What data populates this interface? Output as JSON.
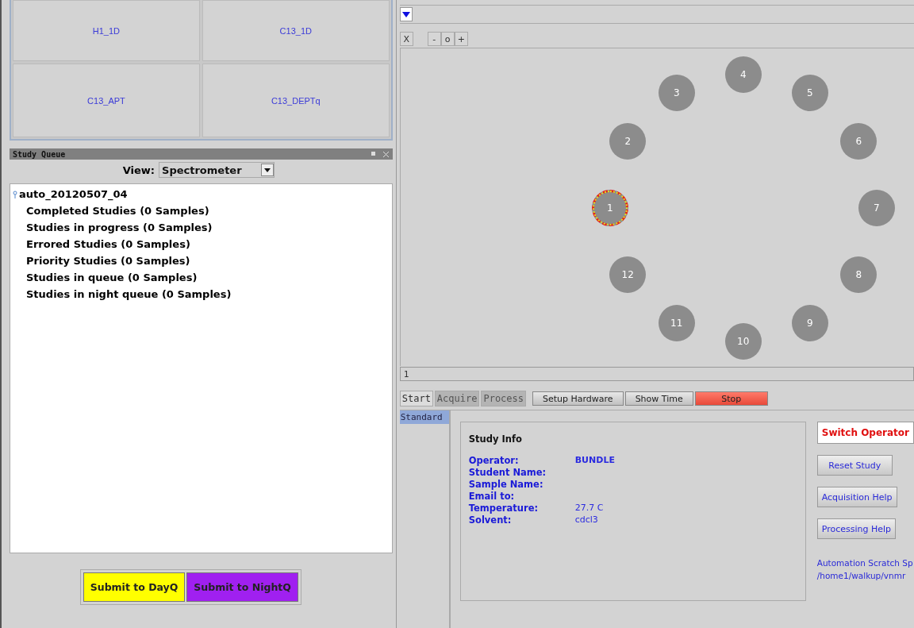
{
  "protocols": [
    {
      "label": "H1_1D"
    },
    {
      "label": "C13_1D"
    },
    {
      "label": "C13_APT"
    },
    {
      "label": "C13_DEPTq"
    }
  ],
  "study_queue": {
    "title": "Study Queue",
    "view_label": "View:",
    "view_value": "Spectrometer",
    "tree": {
      "label": "auto_20120507_04",
      "expanded": true,
      "children": [
        {
          "label": "Completed Studies (0 Samples)"
        },
        {
          "label": "Studies in progress (0 Samples)"
        },
        {
          "label": "Errored Studies (0 Samples)"
        },
        {
          "label": "Priority Studies (0 Samples)"
        },
        {
          "label": "Studies in queue (0 Samples)"
        },
        {
          "label": "Studies in night queue (0 Samples)"
        }
      ]
    },
    "buttons": [
      {
        "label": "Submit to DayQ",
        "color": "#ffff00"
      },
      {
        "label": "Submit to NightQ",
        "color": "#a020f0"
      }
    ]
  },
  "zoom_buttons": [
    "X",
    "-",
    "o",
    "+"
  ],
  "samples": [
    {
      "label": "1",
      "selected": true
    },
    {
      "label": "2",
      "selected": false
    },
    {
      "label": "3",
      "selected": false
    },
    {
      "label": "4",
      "selected": false
    },
    {
      "label": "5",
      "selected": false
    },
    {
      "label": "6",
      "selected": false
    },
    {
      "label": "7",
      "selected": false
    },
    {
      "label": "8",
      "selected": false
    },
    {
      "label": "9",
      "selected": false
    },
    {
      "label": "10",
      "selected": false
    },
    {
      "label": "11",
      "selected": false
    },
    {
      "label": "12",
      "selected": false
    }
  ],
  "location_field": {
    "value": "1"
  },
  "tabs": [
    {
      "label": "Start",
      "selected": true
    },
    {
      "label": "Acquire",
      "selected": false
    },
    {
      "label": "Process",
      "selected": false
    }
  ],
  "actions": [
    {
      "label": "Setup Hardware",
      "kind": "normal"
    },
    {
      "label": "Show Time",
      "kind": "normal"
    },
    {
      "label": "Stop",
      "kind": "danger"
    }
  ],
  "side_items": [
    {
      "label": "Standard",
      "selected": true
    }
  ],
  "study_info": {
    "title": "Study Info",
    "rows": [
      {
        "label": "Operator:",
        "value": "BUNDLE",
        "bold": true
      },
      {
        "label": "Student Name:"
      },
      {
        "label": "Sample Name:"
      },
      {
        "label": "Email to:"
      },
      {
        "label": "Temperature:",
        "value": "27.7 C",
        "bold": false
      },
      {
        "label": "Solvent:",
        "value": "cdcl3",
        "bold": false
      }
    ]
  },
  "side_buttons": [
    {
      "label": "Switch Operator",
      "kind": "alert"
    },
    {
      "label": "Reset Study",
      "kind": "normal"
    },
    {
      "label": "Acquisition Help",
      "kind": "normal"
    },
    {
      "label": "Processing Help",
      "kind": "normal"
    }
  ],
  "scratch": [
    "Automation Scratch Sp",
    "/home1/walkup/vnmr"
  ]
}
